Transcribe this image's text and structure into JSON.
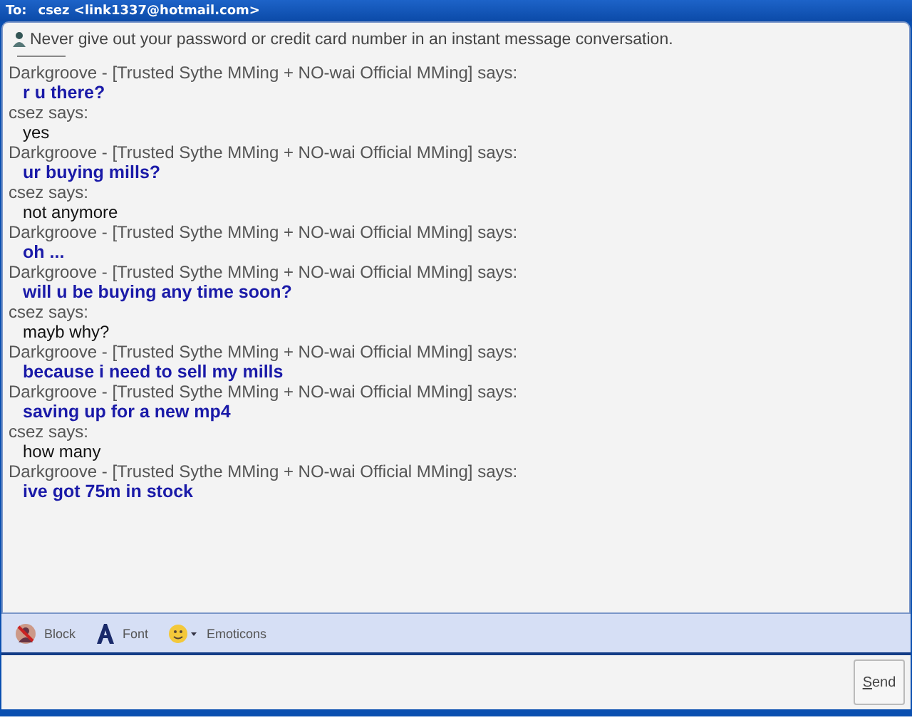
{
  "header": {
    "label": "To:",
    "contact": "csez <link1337@hotmail.com>"
  },
  "warning": "Never give out your password or credit card number in an instant message conversation.",
  "messages": [
    {
      "sender": "Darkgroove - [Trusted Sythe MMing + NO-wai Official MMing] says:",
      "text": "r u there?",
      "kind": "contact"
    },
    {
      "sender": "csez says:",
      "text": "yes",
      "kind": "self"
    },
    {
      "sender": "Darkgroove - [Trusted Sythe MMing + NO-wai Official MMing] says:",
      "text": "ur buying mills?",
      "kind": "contact"
    },
    {
      "sender": "csez says:",
      "text": "not anymore",
      "kind": "self"
    },
    {
      "sender": "Darkgroove - [Trusted Sythe MMing + NO-wai Official MMing] says:",
      "text": "oh ...",
      "kind": "contact"
    },
    {
      "sender": "Darkgroove - [Trusted Sythe MMing + NO-wai Official MMing] says:",
      "text": "will u be buying any time soon?",
      "kind": "contact"
    },
    {
      "sender": "csez says:",
      "text": "mayb why?",
      "kind": "self"
    },
    {
      "sender": "Darkgroove - [Trusted Sythe MMing + NO-wai Official MMing] says:",
      "text": "because i need to sell my mills",
      "kind": "contact"
    },
    {
      "sender": "Darkgroove - [Trusted Sythe MMing + NO-wai Official MMing] says:",
      "text": "saving up for a new mp4",
      "kind": "contact"
    },
    {
      "sender": "csez says:",
      "text": "how many",
      "kind": "self"
    },
    {
      "sender": "Darkgroove - [Trusted Sythe MMing + NO-wai Official MMing] says:",
      "text": "ive got 75m in stock",
      "kind": "contact"
    }
  ],
  "toolbar": [
    {
      "label": "Block",
      "kind": "block"
    },
    {
      "label": "Font",
      "kind": "font"
    },
    {
      "label": "Emoticons",
      "kind": "emoticons"
    }
  ],
  "send_button": "Send"
}
